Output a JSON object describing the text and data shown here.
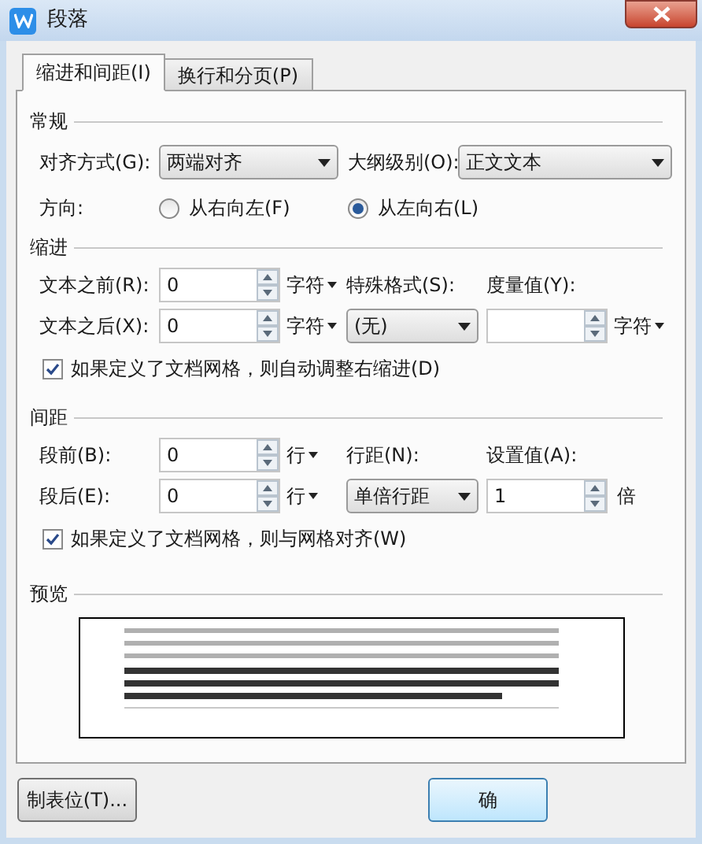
{
  "window": {
    "title": "段落"
  },
  "tabs": [
    {
      "label": "缩进和间距(I)",
      "selected": true
    },
    {
      "label": "换行和分页(P)",
      "selected": false
    }
  ],
  "general": {
    "heading": "常规",
    "alignment": {
      "label": "对齐方式(G):",
      "value": "两端对齐"
    },
    "outline_level": {
      "label": "大纲级别(O):",
      "value": "正文文本"
    },
    "direction": {
      "label": "方向:",
      "options": [
        {
          "label": "从右向左(F)",
          "selected": false
        },
        {
          "label": "从左向右(L)",
          "selected": true
        }
      ]
    }
  },
  "indent": {
    "heading": "缩进",
    "before": {
      "label": "文本之前(R):",
      "value": "0",
      "unit": "字符",
      "dropdown": true
    },
    "after": {
      "label": "文本之后(X):",
      "value": "0",
      "unit": "字符",
      "dropdown": true
    },
    "special": {
      "label": "特殊格式(S):",
      "value": "(无)"
    },
    "measure": {
      "label": "度量值(Y):",
      "unit": "字符",
      "dropdown": true
    },
    "option": {
      "label": "如果定义了文档网格，则自动调整右缩进(D)",
      "checked": true
    }
  },
  "spacing": {
    "heading": "间距",
    "before": {
      "label": "段前(B):",
      "value": "0",
      "unit": "行",
      "dropdown": true
    },
    "after": {
      "label": "段后(E):",
      "value": "0",
      "unit": "行",
      "dropdown": true
    },
    "line_spacing": {
      "label": "行距(N):",
      "value": "单倍行距"
    },
    "setting": {
      "label": "设置值(A):",
      "value": "1",
      "unit": "倍",
      "dropdown": false
    },
    "option": {
      "label": "如果定义了文档网格，则与网格对齐(W)",
      "checked": true
    }
  },
  "preview": {
    "heading": "预览"
  },
  "buttons": [
    {
      "label": "制表位(T)...",
      "kind": "normal"
    },
    {
      "label": "确",
      "kind": "default"
    }
  ]
}
